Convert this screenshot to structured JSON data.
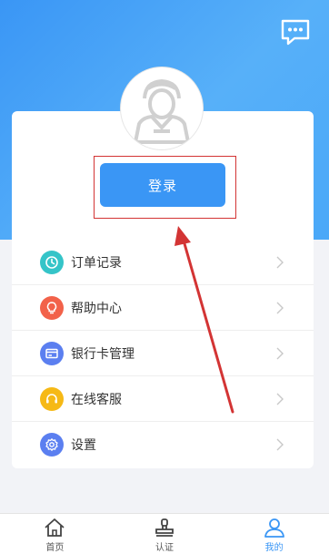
{
  "login": {
    "label": "登录"
  },
  "menu": [
    {
      "label": "订单记录",
      "icon": "clock-icon",
      "color": "#35c4c8"
    },
    {
      "label": "帮助中心",
      "icon": "lightbulb-icon",
      "color": "#f2624a"
    },
    {
      "label": "银行卡管理",
      "icon": "card-icon",
      "color": "#5b7ff0"
    },
    {
      "label": "在线客服",
      "icon": "headset-icon",
      "color": "#f6b916"
    },
    {
      "label": "设置",
      "icon": "gear-icon",
      "color": "#5b7ff0"
    }
  ],
  "tabs": [
    {
      "label": "首页",
      "icon": "home-icon",
      "active": false
    },
    {
      "label": "认证",
      "icon": "stamp-icon",
      "active": false
    },
    {
      "label": "我的",
      "icon": "person-icon",
      "active": true
    }
  ],
  "colors": {
    "accent": "#3a96f5",
    "annotation": "#d33434"
  }
}
